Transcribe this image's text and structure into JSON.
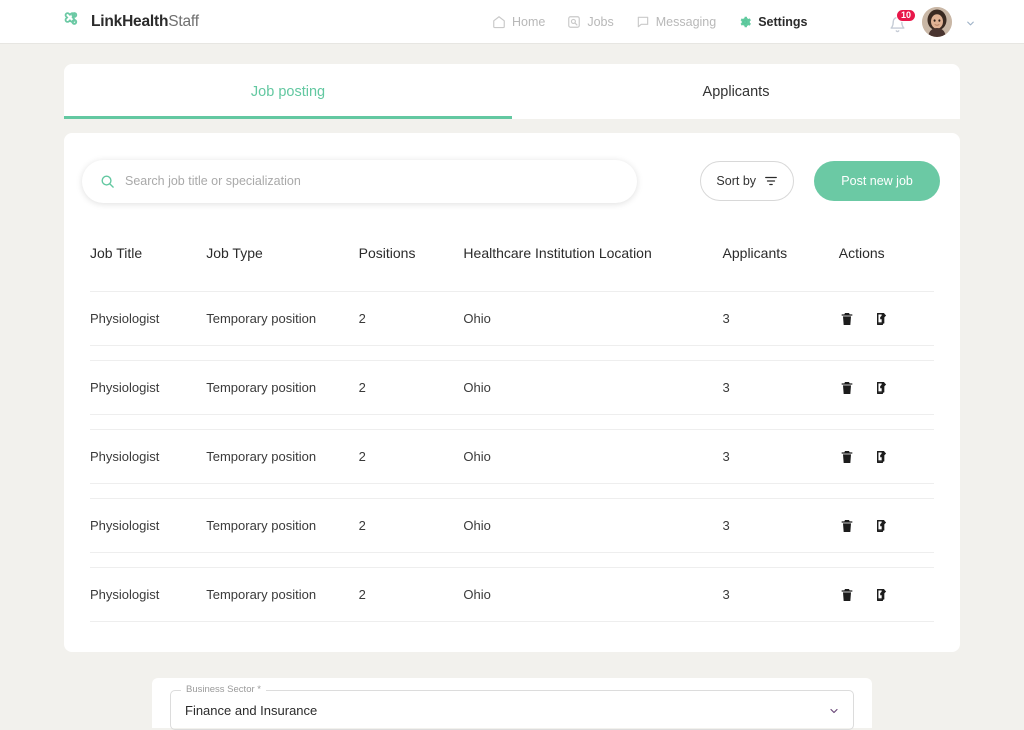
{
  "brand": {
    "name_bold": "LinkHealth",
    "name_light": "Staff",
    "logo_icon": "medical-cross-icon",
    "accent_color": "#63c8a1"
  },
  "nav": {
    "items": [
      {
        "label": "Home",
        "icon": "home-icon",
        "active": false
      },
      {
        "label": "Jobs",
        "icon": "jobs-search-icon",
        "active": false
      },
      {
        "label": "Messaging",
        "icon": "chat-bubble-icon",
        "active": false
      },
      {
        "label": "Settings",
        "icon": "gear-icon",
        "active": true
      }
    ]
  },
  "topright": {
    "bell_icon": "bell-icon",
    "notification_count": "10",
    "badge_color": "#e8174a",
    "avatar_icon": "user-avatar",
    "chevron_icon": "chevron-down-icon"
  },
  "tabs": [
    {
      "label": "Job posting",
      "active": true
    },
    {
      "label": "Applicants",
      "active": false
    }
  ],
  "toolbar": {
    "search_placeholder": "Search job title or specialization",
    "search_value": "",
    "search_icon": "search-icon",
    "sort_label": "Sort by",
    "sort_icon": "filter-icon",
    "post_label": "Post new job"
  },
  "table": {
    "columns": [
      "Job Title",
      "Job Type",
      "Positions",
      "Healthcare Institution Location",
      "Applicants",
      "Actions"
    ],
    "rows": [
      {
        "job_title": "Physiologist",
        "job_type": "Temporary position",
        "positions": "2",
        "location": "Ohio",
        "applicants": "3"
      },
      {
        "job_title": "Physiologist",
        "job_type": "Temporary position",
        "positions": "2",
        "location": "Ohio",
        "applicants": "3"
      },
      {
        "job_title": "Physiologist",
        "job_type": "Temporary position",
        "positions": "2",
        "location": "Ohio",
        "applicants": "3"
      },
      {
        "job_title": "Physiologist",
        "job_type": "Temporary position",
        "positions": "2",
        "location": "Ohio",
        "applicants": "3"
      },
      {
        "job_title": "Physiologist",
        "job_type": "Temporary position",
        "positions": "2",
        "location": "Ohio",
        "applicants": "3"
      }
    ],
    "row_actions": [
      {
        "icon": "delete-icon"
      },
      {
        "icon": "edit-icon"
      }
    ]
  },
  "form": {
    "business_sector_label": "Business Sector *",
    "business_sector_value": "Finance and Insurance",
    "chevron_icon": "chevron-down-icon"
  }
}
